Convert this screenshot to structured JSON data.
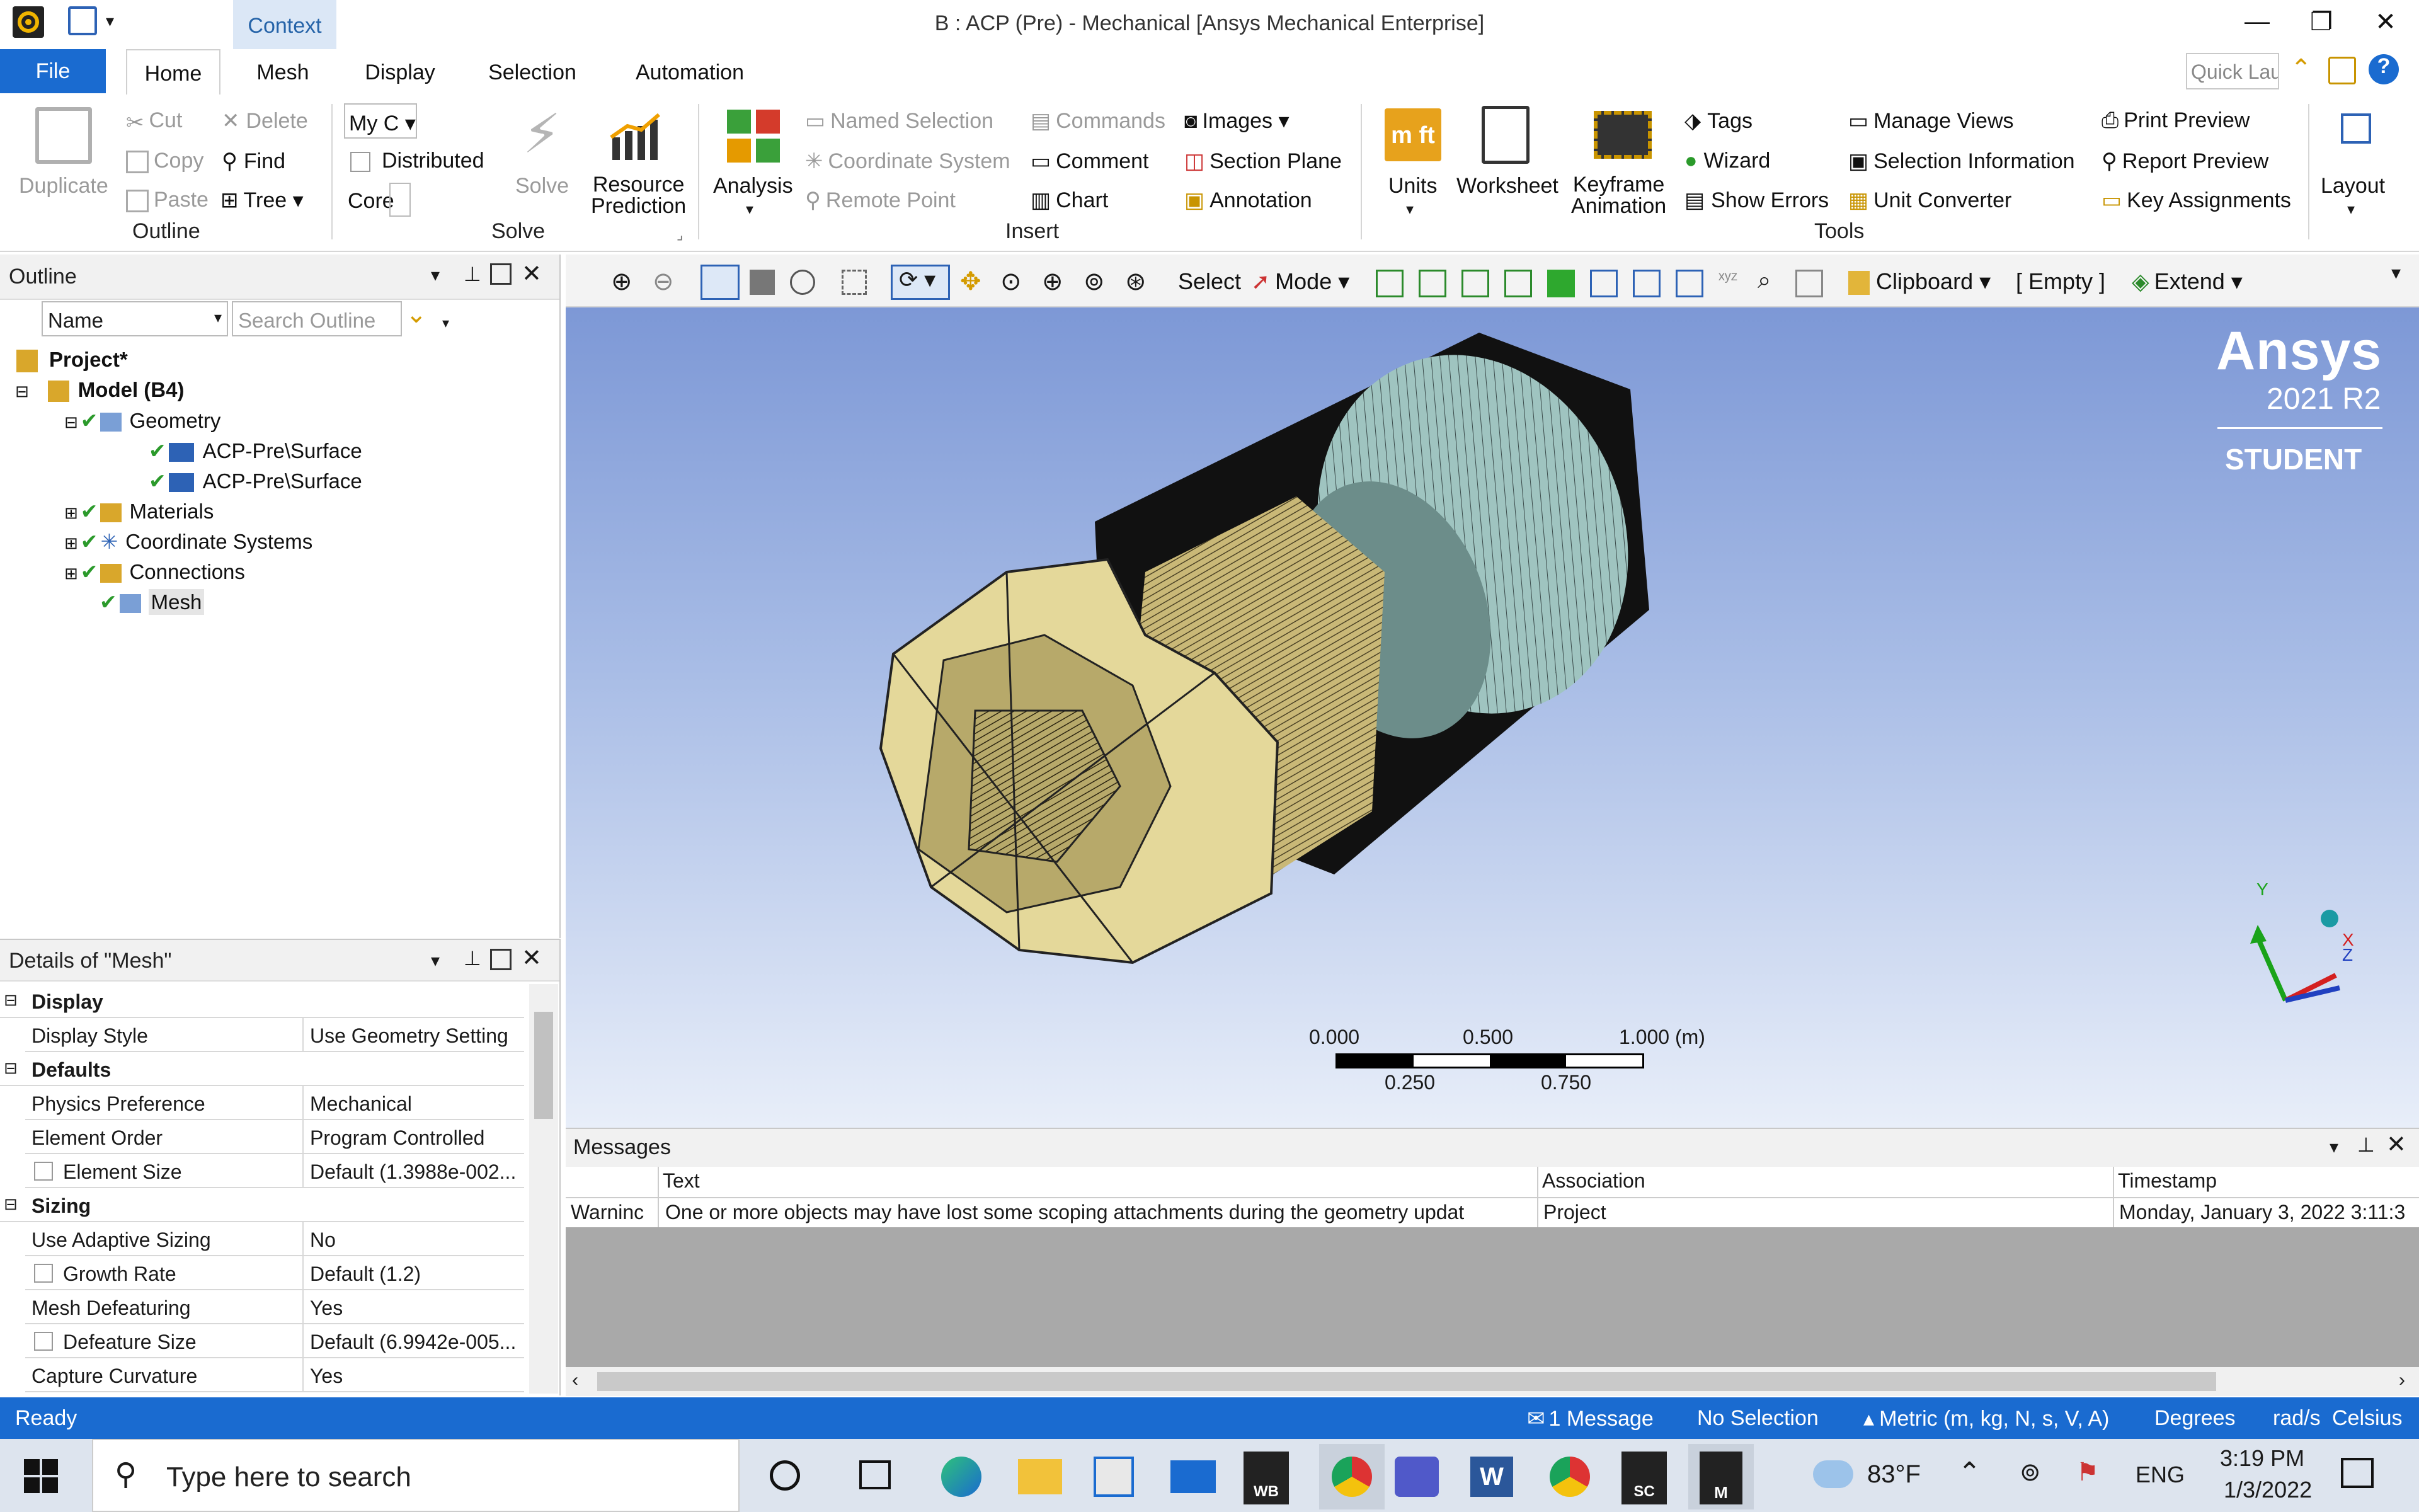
{
  "app": {
    "title": "B : ACP (Pre) - Mechanical [Ansys Mechanical Enterprise]",
    "context_tab": "Context",
    "quick_launch_placeholder": "Quick Lau",
    "icons": {
      "app": "ansys-logo-icon",
      "save": "save-icon",
      "minimize": "minimize-icon",
      "restore": "restore-icon",
      "close": "close-icon"
    }
  },
  "tabs": {
    "file": "File",
    "items": [
      "Home",
      "Mesh",
      "Display",
      "Selection",
      "Automation"
    ],
    "active": "Home"
  },
  "ribbon": {
    "outline": {
      "group": "Outline",
      "duplicate": "Duplicate",
      "cut": "Cut",
      "copy": "Copy",
      "paste": "Paste",
      "delete": "Delete",
      "find": "Find",
      "tree": "Tree"
    },
    "solve": {
      "group": "Solve",
      "my_computer": "My C",
      "distributed": "Distributed",
      "cores": "Core",
      "solve": "Solve",
      "resource": "Resource",
      "prediction": "Prediction"
    },
    "insert": {
      "group": "Insert",
      "analysis": "Analysis",
      "named_selection": "Named Selection",
      "coordinate_system": "Coordinate System",
      "remote_point": "Remote Point",
      "commands": "Commands",
      "comment": "Comment",
      "chart": "Chart",
      "images": "Images",
      "section_plane": "Section Plane",
      "annotation": "Annotation"
    },
    "tools": {
      "group": "Tools",
      "units": "Units",
      "worksheet": "Worksheet",
      "keyframe": "Keyframe",
      "animation": "Animation",
      "tags": "Tags",
      "wizard": "Wizard",
      "show_errors": "Show Errors",
      "manage_views": "Manage Views",
      "selection_information": "Selection Information",
      "unit_converter": "Unit Converter",
      "print_preview": "Print Preview",
      "report_preview": "Report Preview",
      "key_assignments": "Key Assignments"
    },
    "layout": "Layout"
  },
  "toolbar": {
    "select": "Select",
    "mode": "Mode",
    "clipboard": "Clipboard",
    "empty": "[ Empty ]",
    "extend": "Extend"
  },
  "outline": {
    "title": "Outline",
    "filter_name": "Name",
    "search_placeholder": "Search Outline",
    "tree": [
      {
        "label": "Project*",
        "level": 0,
        "bold": true
      },
      {
        "label": "Model (B4)",
        "level": 1,
        "bold": true
      },
      {
        "label": "Geometry",
        "level": 2
      },
      {
        "label": "ACP-Pre\\Surface",
        "level": 3
      },
      {
        "label": "ACP-Pre\\Surface",
        "level": 3
      },
      {
        "label": "Materials",
        "level": 2
      },
      {
        "label": "Coordinate Systems",
        "level": 2
      },
      {
        "label": "Connections",
        "level": 2
      },
      {
        "label": "Mesh",
        "level": 2
      }
    ]
  },
  "details": {
    "title": "Details of \"Mesh\"",
    "sections": {
      "display": "Display",
      "defaults": "Defaults",
      "sizing": "Sizing"
    },
    "rows": [
      {
        "k": "Display Style",
        "v": "Use Geometry Setting"
      },
      {
        "k": "Physics Preference",
        "v": "Mechanical"
      },
      {
        "k": "Element Order",
        "v": "Program Controlled"
      },
      {
        "k": "Element Size",
        "v": "Default (1.3988e-002..."
      },
      {
        "k": "Use Adaptive Sizing",
        "v": "No"
      },
      {
        "k": "Growth Rate",
        "v": "Default (1.2)"
      },
      {
        "k": "Mesh Defeaturing",
        "v": "Yes"
      },
      {
        "k": "Defeature Size",
        "v": "Default (6.9942e-005..."
      },
      {
        "k": "Capture Curvature",
        "v": "Yes"
      }
    ]
  },
  "viewport": {
    "brand": "Ansys",
    "version": "2021 R2",
    "edition": "STUDENT",
    "scale": {
      "top": [
        "0.000",
        "0.500",
        "1.000 (m)"
      ],
      "bottom": [
        "0.250",
        "0.750"
      ]
    },
    "axes": {
      "y": "Y",
      "x": "X",
      "z": "Z"
    }
  },
  "messages": {
    "title": "Messages",
    "columns": [
      "Text",
      "Association",
      "Timestamp"
    ],
    "rows": [
      {
        "type": "Warninc",
        "text": "One or more objects may have lost some scoping attachments during the geometry updat",
        "association": "Project",
        "timestamp": "Monday, January 3, 2022 3:11:3"
      }
    ]
  },
  "status": {
    "ready": "Ready",
    "messages": "1 Message",
    "selection": "No Selection",
    "units": "Metric (m, kg, N, s, V, A)",
    "degrees": "Degrees",
    "rads": "rad/s",
    "temp": "Celsius"
  },
  "taskbar": {
    "search_placeholder": "Type here to search",
    "weather": "83°F",
    "lang": "ENG",
    "time": "3:19 PM",
    "date": "1/3/2022",
    "wb": "WB",
    "sc": "SC",
    "m": "M"
  }
}
